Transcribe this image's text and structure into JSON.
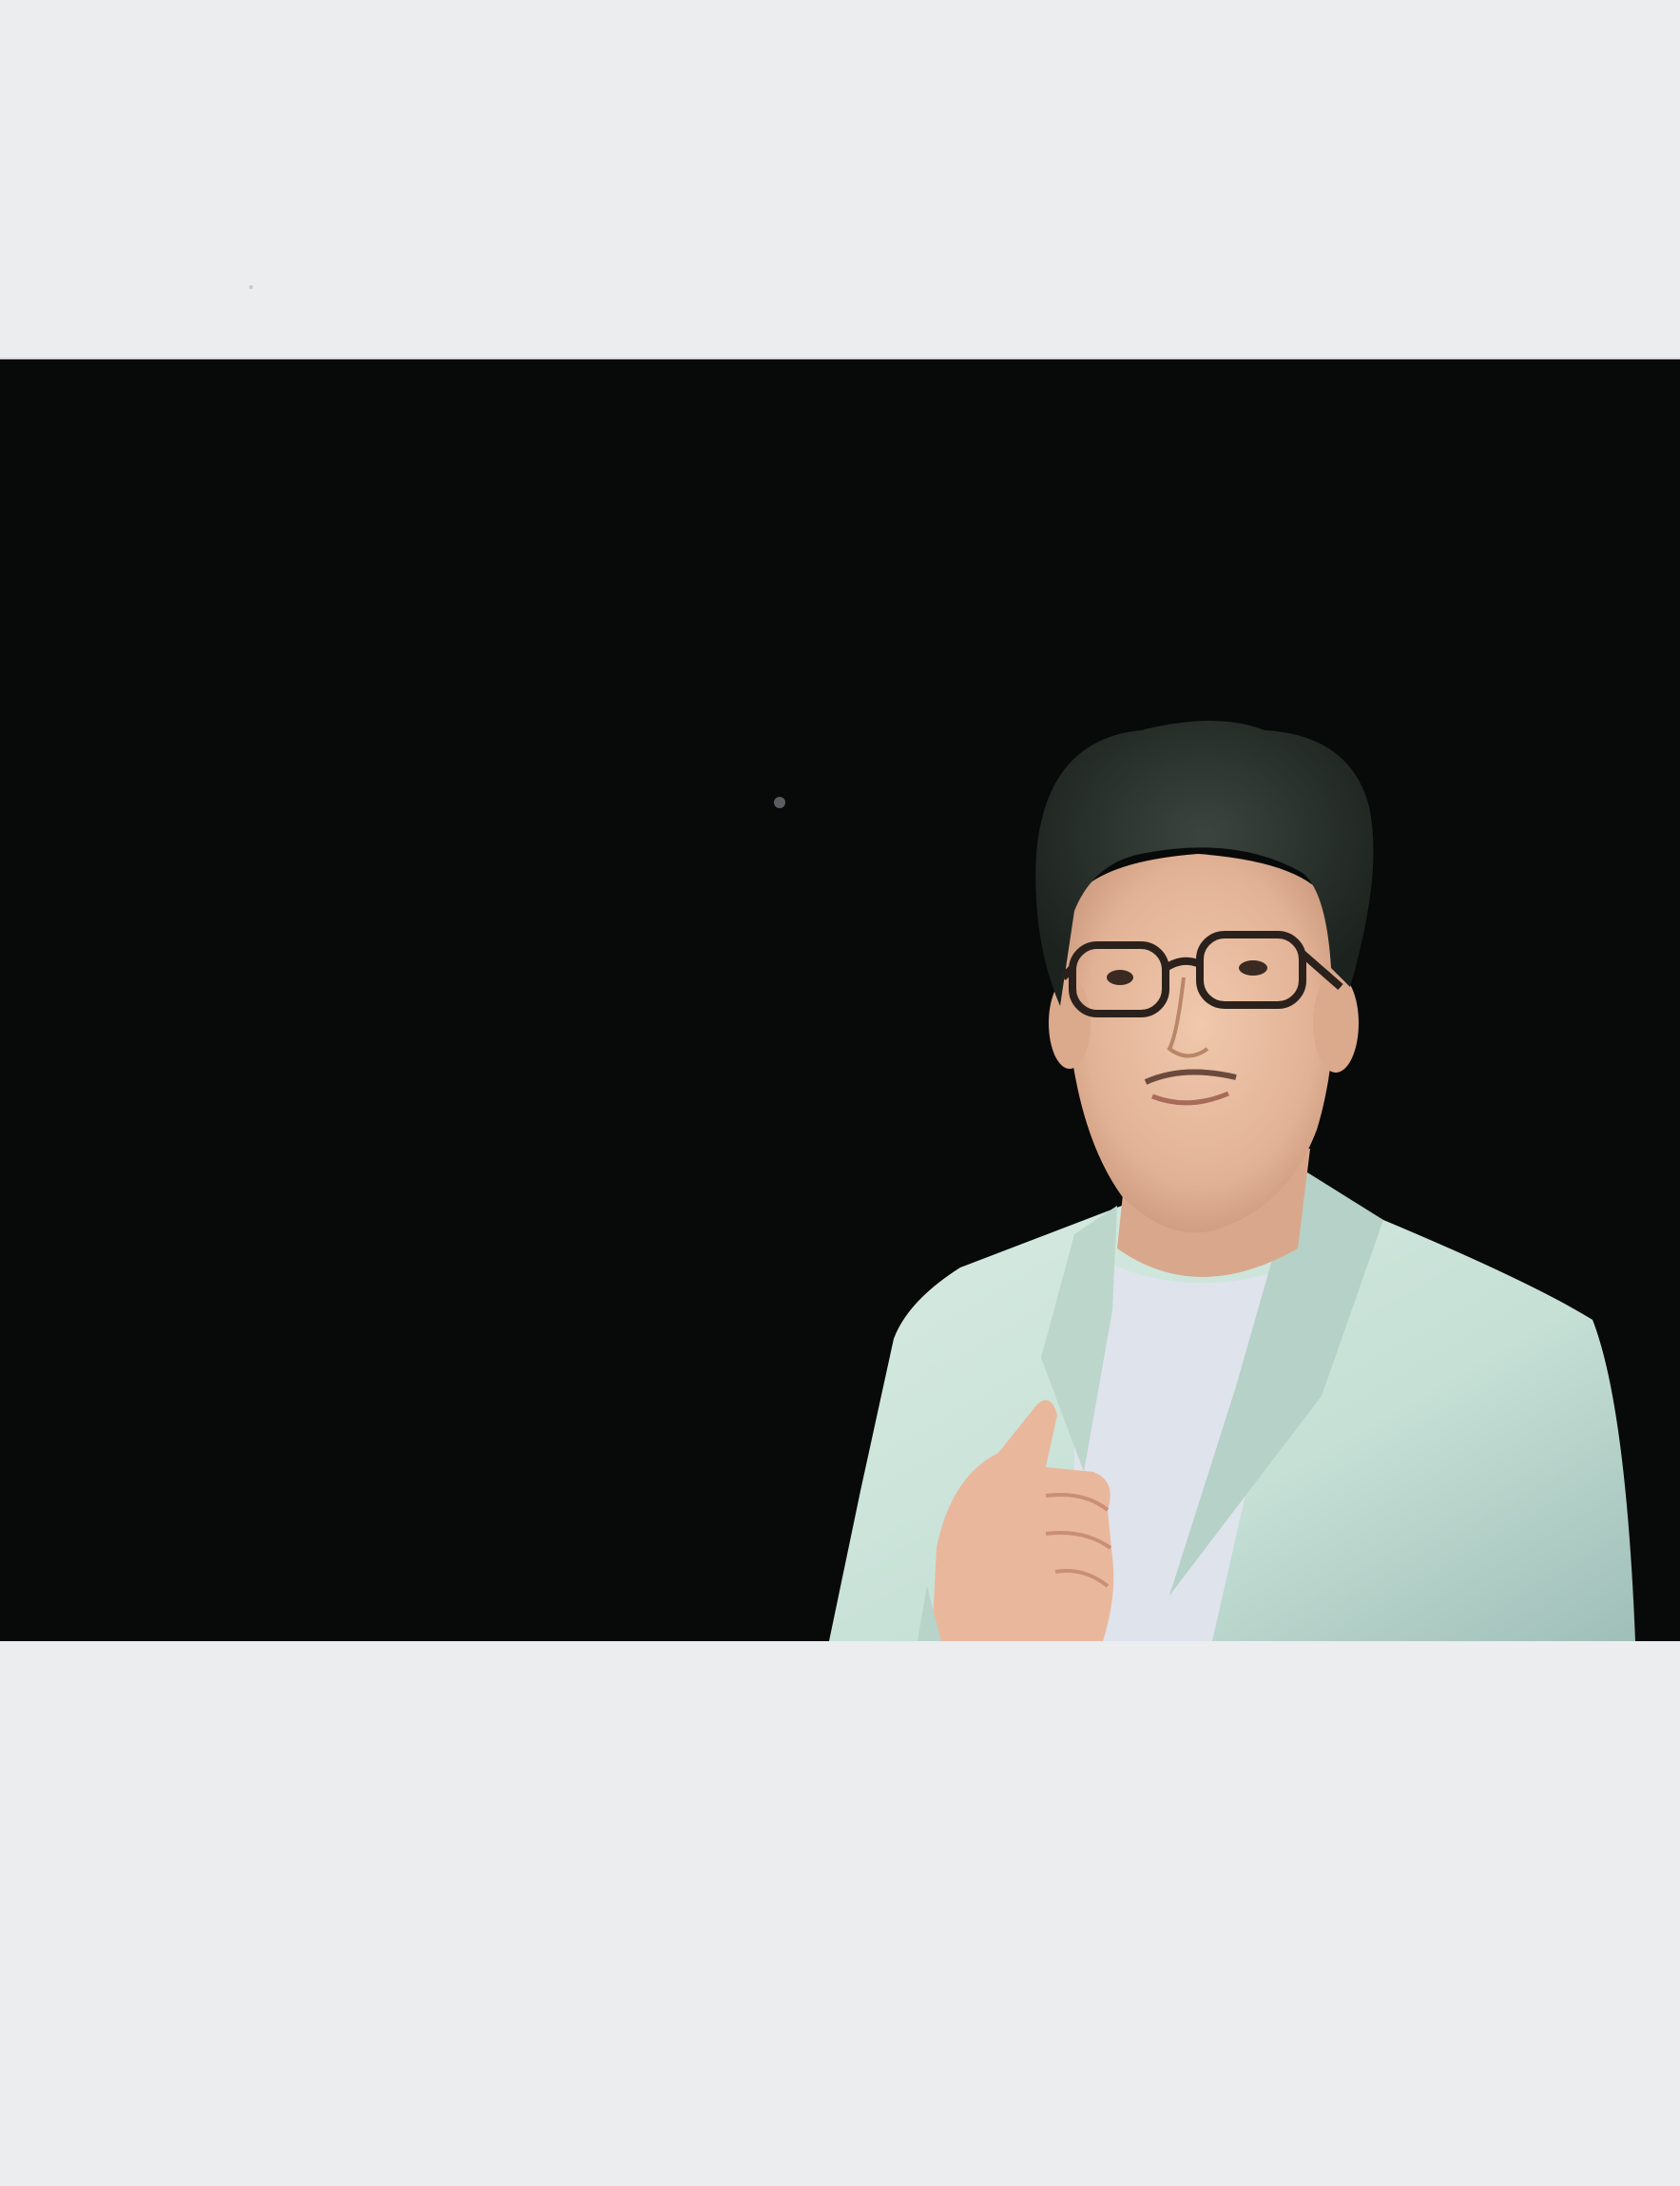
{
  "image": {
    "subject": "portrait-photo",
    "colors": {
      "page_background": "#ecedef",
      "photo_background": "#080909",
      "jacket": "#c9e3d9",
      "tshirt": "#dfe3ec",
      "skin": "#e3b59a",
      "hair": "#2a312c",
      "glasses": "#2b211c"
    }
  }
}
